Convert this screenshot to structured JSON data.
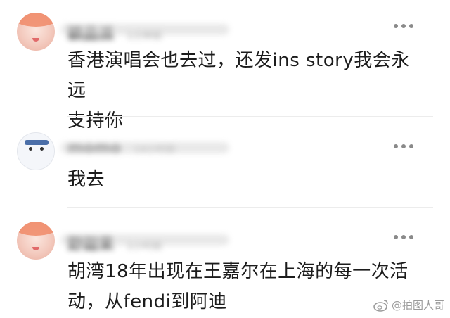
{
  "comments": [
    {
      "username": "颖品派",
      "meta": "1分钟前",
      "text_lines": [
        "香港演唱会也去过，还发ins story我会永远",
        "支持你"
      ],
      "more_icon": "more-dots-icon"
    },
    {
      "username": "momo",
      "meta": "14小时前",
      "text_lines": [
        "我去"
      ],
      "more_icon": "more-dots-icon"
    },
    {
      "username": "野甜果",
      "meta": "1小时前",
      "text_lines": [
        "胡湾18年出现在王嘉尔在上海的每一次活",
        "动，从fendi到阿迪"
      ],
      "more_icon": "more-dots-icon"
    }
  ],
  "watermark": {
    "text": "@拍图人哥",
    "icon": "weibo-logo-icon"
  }
}
